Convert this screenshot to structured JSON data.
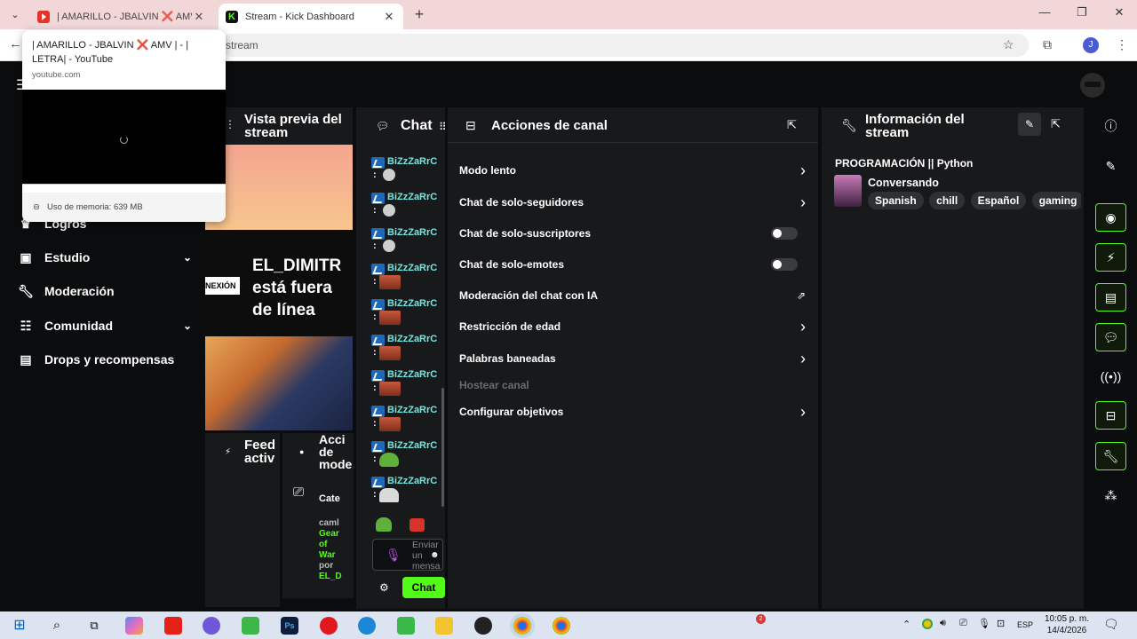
{
  "browser": {
    "tabs": [
      {
        "title": "| AMARILLO - JBALVIN ❌ AMV",
        "close": "✕"
      },
      {
        "title": "Stream - Kick Dashboard",
        "close": "✕"
      }
    ],
    "new_tab": "+",
    "url_fragment": "stream",
    "window_controls": {
      "minimize": "—",
      "maximize": "❐",
      "close": "✕"
    },
    "profile_initial": "J"
  },
  "hovercard": {
    "title": "| AMARILLO - JBALVIN ❌ AMV | - | LETRA| - YouTube",
    "url": "youtube.com",
    "memory": "Uso de memoria: 639 MB"
  },
  "sidebar": {
    "items": [
      {
        "label": "Logros",
        "icon": "trophy-icon",
        "chevron": false
      },
      {
        "label": "Estudio",
        "icon": "studio-icon",
        "chevron": true
      },
      {
        "label": "Moderación",
        "icon": "wrench-icon",
        "chevron": false
      },
      {
        "label": "Comunidad",
        "icon": "community-icon",
        "chevron": true
      },
      {
        "label": "Drops y recompensas",
        "icon": "gift-icon",
        "chevron": false
      }
    ]
  },
  "preview": {
    "title": "Vista previa del stream",
    "badge": "NEXIÓN",
    "offline_text": "EL_DIMITR está fuera de línea"
  },
  "feed": {
    "title": "Feed activ"
  },
  "mod_actions": {
    "title": "Acci de mode",
    "category_label": "Cate",
    "log": [
      "caml",
      "Gear",
      "of",
      "War",
      "por",
      "EL_D"
    ]
  },
  "chat": {
    "title": "Chat",
    "messages": [
      {
        "user": "BiZzZaRrC",
        "emote": "small"
      },
      {
        "user": "BiZzZaRrC",
        "emote": "small"
      },
      {
        "user": "BiZzZaRrC",
        "emote": "small"
      },
      {
        "user": "BiZzZaRrC",
        "emote": "face"
      },
      {
        "user": "BiZzZaRrC",
        "emote": "face"
      },
      {
        "user": "BiZzZaRrC",
        "emote": "face"
      },
      {
        "user": "BiZzZaRrC",
        "emote": "face"
      },
      {
        "user": "BiZzZaRrC",
        "emote": "face"
      },
      {
        "user": "BiZzZaRrC",
        "emote": "frog"
      },
      {
        "user": "BiZzZaRrC",
        "emote": "cat"
      }
    ],
    "input_placeholder": "Enviar un mensa",
    "send_label": "Chat"
  },
  "actions": {
    "title": "Acciones de canal",
    "rows": [
      {
        "label": "Modo lento",
        "control": "chevron",
        "disabled": false
      },
      {
        "label": "Chat de solo-seguidores",
        "control": "chevron",
        "disabled": false
      },
      {
        "label": "Chat de solo-suscriptores",
        "control": "toggle",
        "state": "off",
        "disabled": false
      },
      {
        "label": "Chat de solo-emotes",
        "control": "toggle",
        "state": "off",
        "disabled": false
      },
      {
        "label": "Moderación del chat con IA",
        "control": "external",
        "disabled": false
      },
      {
        "label": "Restricción de edad",
        "control": "chevron",
        "disabled": false
      },
      {
        "label": "Palabras baneadas",
        "control": "chevron",
        "disabled": false
      },
      {
        "label": "Hostear canal",
        "control": "none",
        "disabled": true
      },
      {
        "label": "Configurar objetivos",
        "control": "chevron",
        "disabled": false
      }
    ]
  },
  "info": {
    "title": "Información del stream",
    "stream_title": "PROGRAMACIÓN || Python",
    "category": "Conversando",
    "tags": [
      "Spanish",
      "chill",
      "Español",
      "gaming"
    ]
  },
  "taskbar": {
    "language": "ESP",
    "time": "10:05 p. m.",
    "date": "14/4/2026",
    "notification_count": "2"
  },
  "colors": {
    "accent": "#53fc18",
    "panel": "#18191b",
    "background": "#0b0c0e",
    "chat_username": "#75e6e0"
  }
}
